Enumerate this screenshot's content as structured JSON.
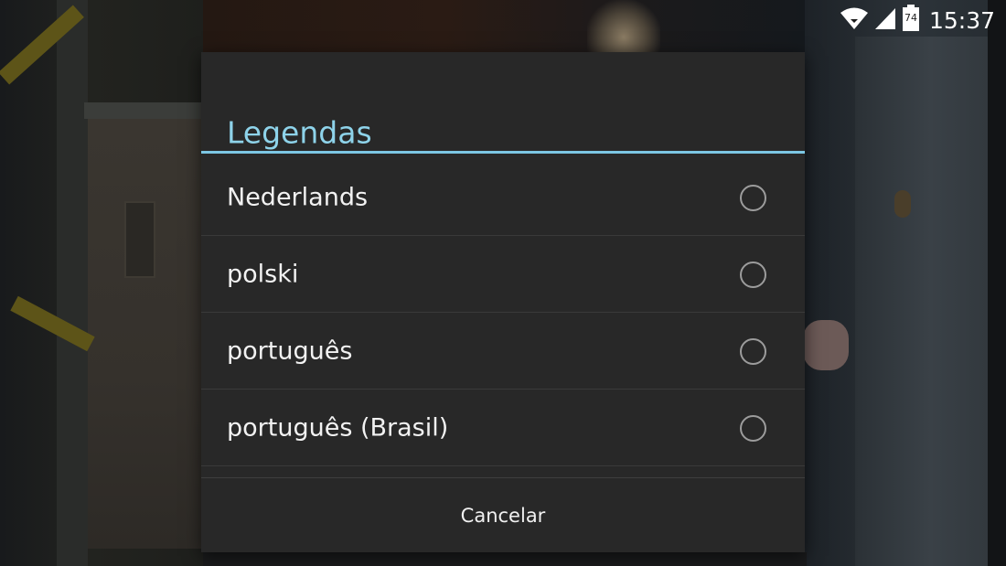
{
  "status_bar": {
    "time": "15:37",
    "battery_level": "74",
    "icons": [
      "wifi-icon",
      "signal-icon",
      "battery-icon"
    ]
  },
  "dialog": {
    "title": "Legendas",
    "options": [
      {
        "label": "Nederlands",
        "selected": false
      },
      {
        "label": "polski",
        "selected": false
      },
      {
        "label": "português",
        "selected": false
      },
      {
        "label": "português (Brasil)",
        "selected": false
      }
    ],
    "cancel_label": "Cancelar"
  },
  "colors": {
    "accent": "#8ed3ea",
    "divider_accent": "#7cc6e3",
    "dialog_background": "#282828"
  }
}
